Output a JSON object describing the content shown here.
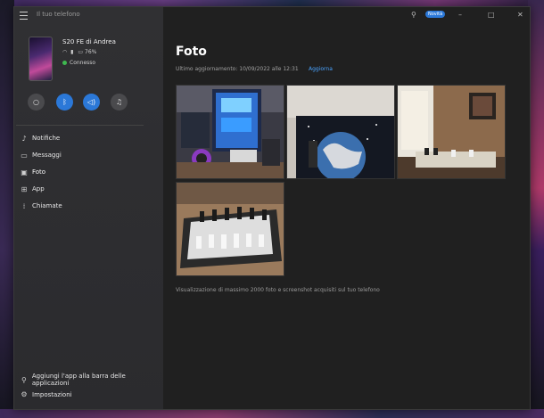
{
  "window": {
    "title": "Il tuo telefono"
  },
  "titlebar": {
    "new_badge": "Novità",
    "minimize_icon": "minimize-icon",
    "maximize_icon": "maximize-icon",
    "close_icon": "close-icon",
    "pin_icon": "pin-icon"
  },
  "device": {
    "name": "S20 FE di Andrea",
    "battery": "76%",
    "status": "Connesso"
  },
  "quick_actions": [
    {
      "name": "do-not-disturb-button",
      "icon": "moon-icon"
    },
    {
      "name": "bluetooth-button",
      "icon": "bluetooth-icon"
    },
    {
      "name": "audio-button",
      "icon": "speaker-icon"
    },
    {
      "name": "music-button",
      "icon": "music-note-icon"
    }
  ],
  "sidebar": {
    "items": [
      {
        "label": "Notifiche",
        "icon": "bell-icon"
      },
      {
        "label": "Messaggi",
        "icon": "chat-icon"
      },
      {
        "label": "Foto",
        "icon": "photo-icon"
      },
      {
        "label": "App",
        "icon": "apps-icon"
      },
      {
        "label": "Chiamate",
        "icon": "dialpad-icon"
      }
    ],
    "bottom": {
      "pin_apps": "Aggiungi l'app alla barra delle applicazioni",
      "settings": "Impostazioni"
    }
  },
  "main": {
    "title": "Foto",
    "last_update": "Ultimo aggiornamento: 10/09/2022 alle 12:31",
    "refresh": "Aggiorna",
    "note": "Visualizzazione di massimo 2000 foto e screenshot acquisiti sul tuo telefono",
    "photos": [
      {
        "name": "gaming-pc-photo"
      },
      {
        "name": "world-map-wall-photo"
      },
      {
        "name": "chess-window-photo"
      },
      {
        "name": "chess-board-photo"
      }
    ]
  },
  "colors": {
    "accent": "#2b78d8",
    "connected": "#3fb950",
    "link": "#4aa3ff"
  }
}
